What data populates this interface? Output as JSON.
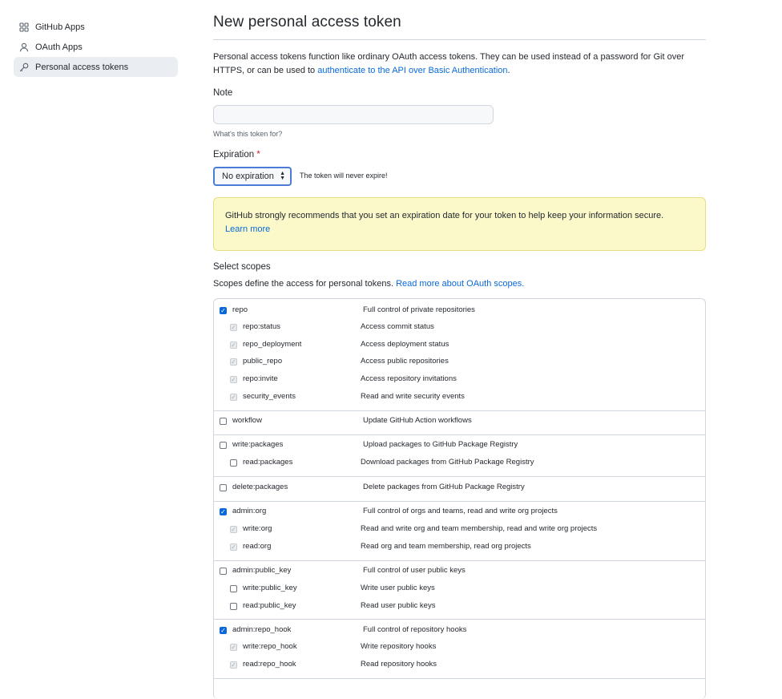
{
  "sidebar": {
    "items": [
      {
        "label": "GitHub Apps",
        "icon": "apps-icon"
      },
      {
        "label": "OAuth Apps",
        "icon": "person-icon"
      },
      {
        "label": "Personal access tokens",
        "icon": "key-icon"
      }
    ]
  },
  "page": {
    "title": "New personal access token",
    "intro_text": "Personal access tokens function like ordinary OAuth access tokens. They can be used instead of a password for Git over HTTPS, or can be used to ",
    "intro_link": "authenticate to the API over Basic Authentication",
    "intro_end": "."
  },
  "note": {
    "label": "Note",
    "value": "",
    "placeholder": "",
    "hint": "What's this token for?"
  },
  "expiration": {
    "label": "Expiration",
    "required_mark": "*",
    "selected": "No expiration",
    "message": "The token will never expire!"
  },
  "warning": {
    "text": "GitHub strongly recommends that you set an expiration date for your token to help keep your information secure.",
    "link": "Learn more",
    "bg_color": "#fbf9c9"
  },
  "scopes": {
    "heading": "Select scopes",
    "desc_text": "Scopes define the access for personal tokens. ",
    "desc_link": "Read more about OAuth scopes.",
    "groups": [
      {
        "name": "repo",
        "desc": "Full control of private repositories",
        "checked": true,
        "children": [
          {
            "name": "repo:status",
            "desc": "Access commit status",
            "checked": true,
            "disabled": true
          },
          {
            "name": "repo_deployment",
            "desc": "Access deployment status",
            "checked": true,
            "disabled": true
          },
          {
            "name": "public_repo",
            "desc": "Access public repositories",
            "checked": true,
            "disabled": true
          },
          {
            "name": "repo:invite",
            "desc": "Access repository invitations",
            "checked": true,
            "disabled": true
          },
          {
            "name": "security_events",
            "desc": "Read and write security events",
            "checked": true,
            "disabled": true
          }
        ]
      },
      {
        "name": "workflow",
        "desc": "Update GitHub Action workflows",
        "checked": false,
        "children": []
      },
      {
        "name": "write:packages",
        "desc": "Upload packages to GitHub Package Registry",
        "checked": false,
        "children": [
          {
            "name": "read:packages",
            "desc": "Download packages from GitHub Package Registry",
            "checked": false,
            "disabled": false
          }
        ]
      },
      {
        "name": "delete:packages",
        "desc": "Delete packages from GitHub Package Registry",
        "checked": false,
        "children": []
      },
      {
        "name": "admin:org",
        "desc": "Full control of orgs and teams, read and write org projects",
        "checked": true,
        "children": [
          {
            "name": "write:org",
            "desc": "Read and write org and team membership, read and write org projects",
            "checked": true,
            "disabled": true
          },
          {
            "name": "read:org",
            "desc": "Read org and team membership, read org projects",
            "checked": true,
            "disabled": true
          }
        ]
      },
      {
        "name": "admin:public_key",
        "desc": "Full control of user public keys",
        "checked": false,
        "children": [
          {
            "name": "write:public_key",
            "desc": "Write user public keys",
            "checked": false,
            "disabled": false
          },
          {
            "name": "read:public_key",
            "desc": "Read user public keys",
            "checked": false,
            "disabled": false
          }
        ]
      },
      {
        "name": "admin:repo_hook",
        "desc": "Full control of repository hooks",
        "checked": true,
        "children": [
          {
            "name": "write:repo_hook",
            "desc": "Write repository hooks",
            "checked": true,
            "disabled": true
          },
          {
            "name": "read:repo_hook",
            "desc": "Read repository hooks",
            "checked": true,
            "disabled": true
          }
        ]
      }
    ]
  },
  "colors": {
    "accent": "#0969da",
    "link": "#0969da",
    "required": "#cf222e",
    "border": "#d0d7de"
  }
}
